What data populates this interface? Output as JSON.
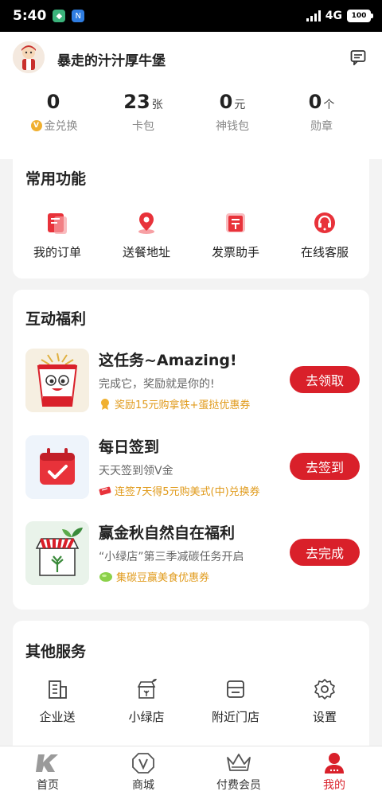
{
  "status_bar": {
    "time": "5:40",
    "network": "4G",
    "battery": "100"
  },
  "profile": {
    "username": "暴走的汁汁厚牛堡"
  },
  "stats": [
    {
      "value": "0",
      "unit": "",
      "label": "金兑换"
    },
    {
      "value": "23",
      "unit": "张",
      "label": "卡包"
    },
    {
      "value": "0",
      "unit": "元",
      "label": "神钱包"
    },
    {
      "value": "0",
      "unit": "个",
      "label": "勋章"
    }
  ],
  "common": {
    "title": "常用功能",
    "items": [
      {
        "label": "我的订单",
        "icon": "order-icon"
      },
      {
        "label": "送餐地址",
        "icon": "location-icon"
      },
      {
        "label": "发票助手",
        "icon": "invoice-icon"
      },
      {
        "label": "在线客服",
        "icon": "headset-icon"
      }
    ]
  },
  "benefits": {
    "title": "互动福利",
    "tasks": [
      {
        "title": "这任务~Amazing!",
        "desc": "完成它，奖励就是你的!",
        "reward": "奖励15元购拿铁+蛋挞优惠券",
        "button": "去领取"
      },
      {
        "title": "每日签到",
        "desc": "天天签到领V金",
        "reward": "连签7天得5元购美式(中)兑换券",
        "button": "去签到"
      },
      {
        "title": "赢金秋自然自在福利",
        "desc": "“小绿店”第三季减碳任务开启",
        "reward": "集碳豆赢美食优惠券",
        "button": "去完成"
      }
    ]
  },
  "other": {
    "title": "其他服务",
    "items": [
      {
        "label": "企业送",
        "icon": "building-icon"
      },
      {
        "label": "小绿店",
        "icon": "green-store-icon"
      },
      {
        "label": "附近门店",
        "icon": "store-icon"
      },
      {
        "label": "设置",
        "icon": "gear-icon"
      }
    ]
  },
  "tabbar": {
    "items": [
      {
        "label": "首页",
        "icon": "kfc-logo-icon"
      },
      {
        "label": "商城",
        "icon": "v-shield-icon"
      },
      {
        "label": "付费会员",
        "icon": "crown-icon"
      },
      {
        "label": "我的",
        "icon": "person-icon",
        "active": true
      }
    ]
  },
  "colors": {
    "accent": "#d9202a",
    "reward": "#e09a1a",
    "background": "#f3f3f3"
  }
}
